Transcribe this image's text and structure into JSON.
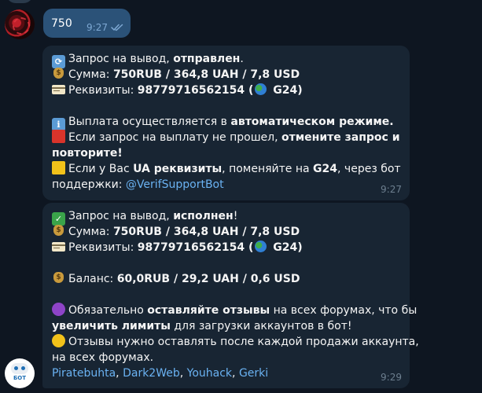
{
  "outgoing": {
    "text": "750",
    "time": "9:27",
    "status_icon": "double-check-icon"
  },
  "message1": {
    "l1_pre": "Запрос на вывод, ",
    "l1_bold": "отправлен",
    "l1_post": ".",
    "l2_pre": "Сумма: ",
    "l2_bold": "750RUB  / 364,8 UAH / 7,8 USD",
    "l3_pre": "Реквизиты: ",
    "l3_bold": "98779716562154 (",
    "l3_bold2": " G24)",
    "l4_pre": "Выплата осуществляется в ",
    "l4_bold": "автоматическом режиме.",
    "l5_pre": "Если запрос на выплату не прошел, ",
    "l5_bold": "отмените запрос и",
    "l6_bold": "повторите!",
    "l7_pre": "Если у Вас ",
    "l7_bold1": "UA реквизиты",
    "l7_mid": ", поменяйте на ",
    "l7_bold2": "G24",
    "l7_post": ", через бот",
    "l8_pre": "поддержки: ",
    "l8_link": "@VerifSupportBot",
    "time": "9:27"
  },
  "message2": {
    "l1_pre": "Запрос на вывод, ",
    "l1_bold": "исполнен",
    "l1_post": "!",
    "l2_pre": "Сумма: ",
    "l2_bold": "750RUB  / 364,8 UAH / 7,8 USD",
    "l3_pre": "Реквизиты: ",
    "l3_bold": "98779716562154 (",
    "l3_bold2": " G24)",
    "l4_pre": "Баланс: ",
    "l4_bold": "60,0RUB  / 29,2 UAH / 0,6 USD",
    "l5_pre": "Обязательно ",
    "l5_bold": "оставляйте отзывы",
    "l5_post": " на всех форумах, что бы",
    "l6_bold": "увеличить лимиты",
    "l6_post": " для загрузки аккаунтов в бот!",
    "l7": "Отзывы нужно оставлять после каждой продажи аккаунта,",
    "l8": "на всех форумах.",
    "forums": [
      "Piratebuhta",
      "Dark2Web",
      "Youhack",
      "Gerki"
    ],
    "sep": ", ",
    "time": "9:29"
  },
  "bot_avatar_label": "БОТ",
  "colors": {
    "background": "#0e1621",
    "incoming_bubble": "#182533",
    "outgoing_bubble": "#2b5278",
    "link": "#6ab2f2",
    "meta": "#6d7f8f"
  }
}
